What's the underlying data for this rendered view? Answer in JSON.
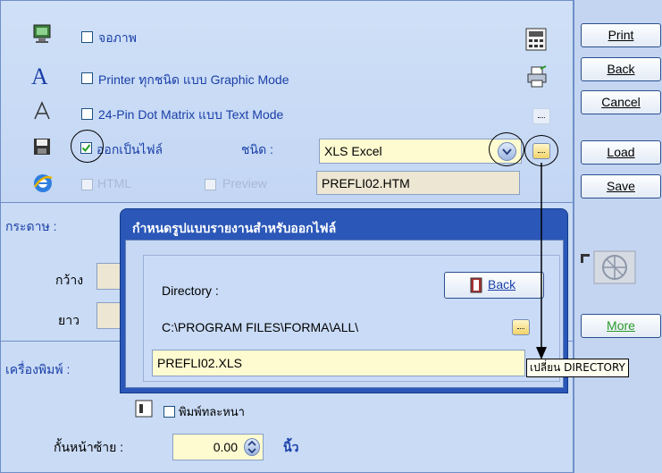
{
  "output_options": {
    "screen_label": "จอภาพ",
    "printer_graphic_label": "Printer ทุกชนิด แบบ Graphic Mode",
    "dot_matrix_label": "24-Pin Dot Matrix แบบ Text Mode",
    "file_label": "ออกเป็นไฟล์",
    "file_type_caption": "ชนิด :",
    "file_type_value": "XLS Excel",
    "html_label": "HTML",
    "preview_label": "Preview",
    "html_filename": "PREFLI02.HTM"
  },
  "buttons": {
    "print": "Print",
    "back": "Back",
    "cancel": "Cancel",
    "load": "Load",
    "save": "Save",
    "more": "More"
  },
  "paper": {
    "section_label": "กระดาษ :",
    "width_label": "กว้าง",
    "length_label": "ยาว"
  },
  "printer": {
    "section_label": "เครื่องพิมพ์ :",
    "draft_label": "พิมพ์ทละหนา",
    "left_margin_label": "กั้นหน้าซ้าย :",
    "left_margin_value": "0.00",
    "left_margin_unit": "นิ้ว"
  },
  "dialog": {
    "title": "กำหนดรูปแบบรายงานสำหรับออกไฟล์",
    "directory_label": "Directory :",
    "back_label": "Back",
    "directory_path": "C:\\PROGRAM FILES\\FORMA\\ALL\\",
    "filename": "PREFLI02.XLS"
  },
  "tooltip": {
    "text": "เปลี่ยน DIRECTORY"
  },
  "colors": {
    "dialog_title_bar": "#2b57b8",
    "panel_background": "#c9dbf5",
    "field_background": "#fffbd1",
    "label_blue": "#1a3fa8"
  }
}
